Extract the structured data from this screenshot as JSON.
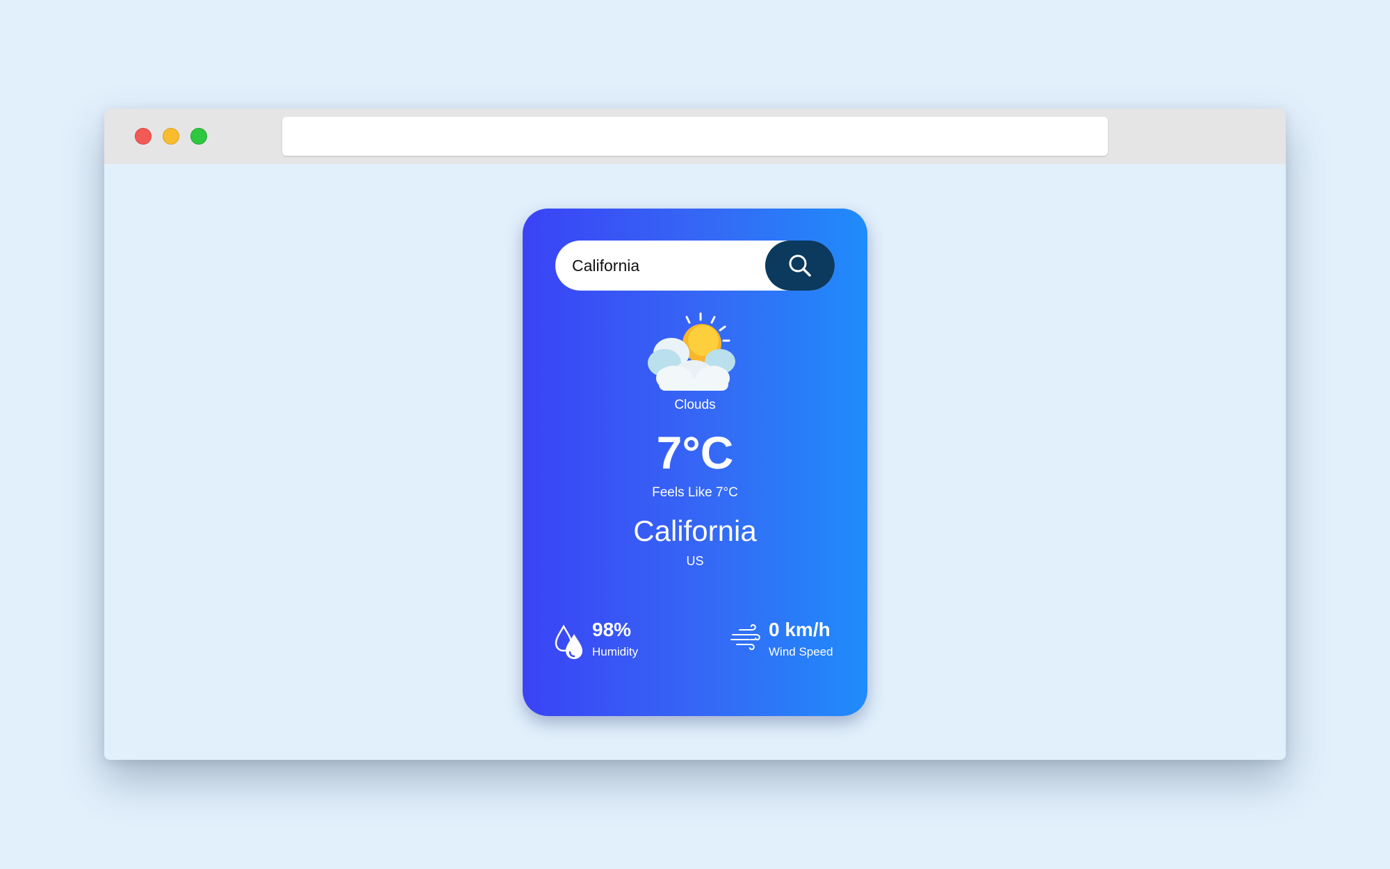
{
  "search": {
    "value": "California",
    "placeholder": "",
    "button_icon": "search-icon"
  },
  "weather": {
    "icon": "sun-behind-clouds-icon",
    "condition": "Clouds",
    "temperature": "7°C",
    "feels_like": "Feels Like 7°C",
    "city": "California",
    "country": "US"
  },
  "stats": {
    "humidity": {
      "value": "98%",
      "label": "Humidity",
      "icon": "humidity-drops-icon"
    },
    "wind": {
      "value": "0 km/h",
      "label": "Wind Speed",
      "icon": "wind-icon"
    }
  },
  "colors": {
    "page_background": "#e2f0fc",
    "card_gradient_start": "#3a43f5",
    "card_gradient_end": "#1f8cfb",
    "search_button": "#0b3a5e"
  }
}
